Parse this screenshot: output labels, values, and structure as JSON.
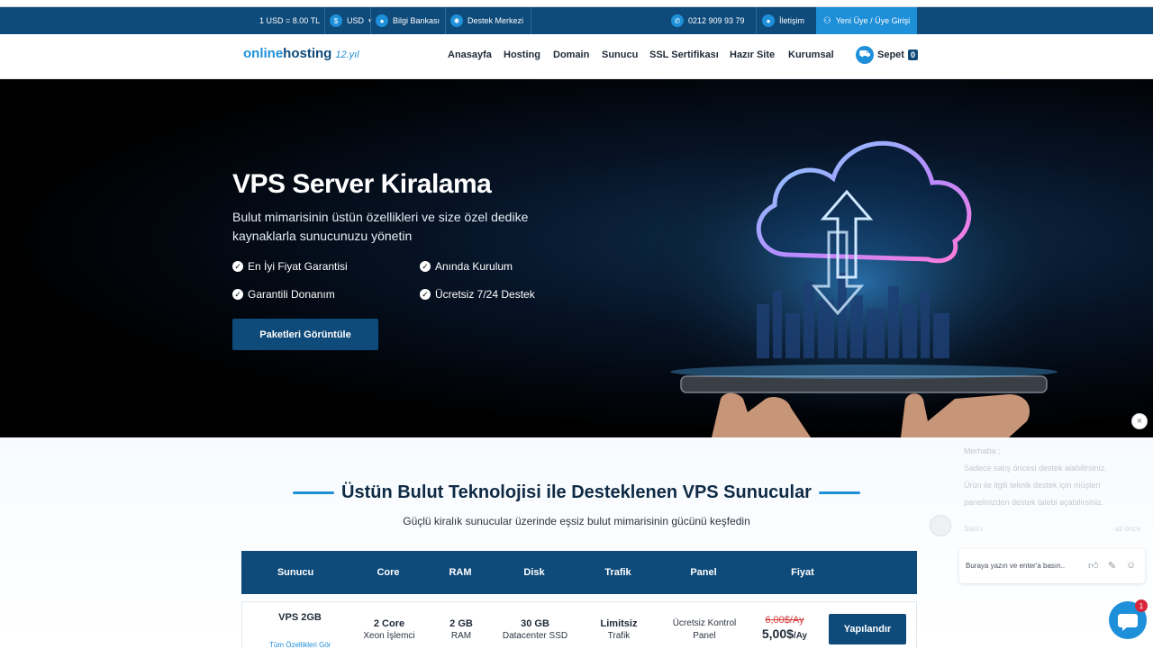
{
  "topbar": {
    "rate": "1 USD = 8.00 TL",
    "currency": "USD",
    "knowledge_base": "Bilgi Bankası",
    "support_center": "Destek Merkezi",
    "phone": "0212 909 93 79",
    "contact": "İletişim",
    "login": "Yeni Üye / Üye Girişi"
  },
  "logo": {
    "part1": "online",
    "part2": "hosting",
    "tagline": "12.yıl"
  },
  "nav": {
    "items": [
      "Anasayfa",
      "Hosting",
      "Domain",
      "Sunucu",
      "SSL Sertifikası",
      "Hazır Site",
      "Kurumsal"
    ],
    "cart_label": "Sepet",
    "cart_count": "0"
  },
  "hero": {
    "title": "VPS Server Kiralama",
    "subtitle": "Bulut mimarisinin üstün özellikleri ve size özel dedike kaynaklarla sunucunuzu yönetin",
    "features": [
      "En İyi Fiyat Garantisi",
      "Anında Kurulum",
      "Garantili Donanım",
      "Ücretsiz 7/24 Destek"
    ],
    "button": "Paketleri Görüntüle"
  },
  "section": {
    "title": "Üstün Bulut Teknolojisi ile Desteklenen VPS Sunucular",
    "subtitle": "Güçlü kiralık sunucular üzerinde eşsiz bulut mimarisinin gücünü keşfedin"
  },
  "table": {
    "headers": [
      "Sunucu",
      "Core",
      "RAM",
      "Disk",
      "Trafik",
      "Panel",
      "Fiyat"
    ],
    "row": {
      "name": "VPS 2GB",
      "all_features": "Tüm Özellikleri Gör",
      "core_value": "2 Core",
      "core_sub": "Xeon İşlemci",
      "ram_value": "2 GB",
      "ram_sub": "RAM",
      "disk_value": "30 GB",
      "disk_sub": "Datacenter SSD",
      "traffic_value": "Limitsiz",
      "traffic_sub": "Trafik",
      "panel_line1": "Ücretsiz Kontrol",
      "panel_line2": "Panel",
      "old_price": "6,00$/Ay",
      "new_price": "5,00$",
      "per": "/Ay",
      "button": "Yapılandır"
    }
  },
  "chat": {
    "close": "×",
    "message_lines": [
      "Merhaba ;",
      "Sadece satış öncesi destek alabilirsiniz.",
      "Ürün ile ilgili teknik destek için müşteri",
      "panelinizden destek talebi açabilirsiniz."
    ],
    "agent": "Satıcı",
    "time": "az önce",
    "placeholder": "Buraya yazın ve enter'a basın..",
    "badge": "1"
  },
  "colors": {
    "primary": "#0e4a7a",
    "accent": "#1e8fd9",
    "price_old": "#d33b3b"
  }
}
